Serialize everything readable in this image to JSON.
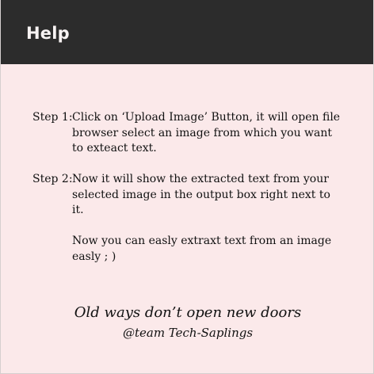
{
  "header": {
    "title": "Help"
  },
  "steps": [
    {
      "label": "Step 1:",
      "paragraphs": [
        "Click on ‘Upload Image’ Button, it will open file browser select an image from which you want to exteact text."
      ]
    },
    {
      "label": "Step 2:",
      "paragraphs": [
        "Now it will show the extracted text from your selected image in the output box right next to it.",
        "Now you can easly extraxt text from an image easly ; )"
      ]
    }
  ],
  "footer": {
    "quote": "Old ways don’t open new doors",
    "team": "@team Tech-Saplings"
  },
  "colors": {
    "header_background": "#2c2c2c",
    "panel_background": "#fbe9ea",
    "text": "#111111"
  }
}
